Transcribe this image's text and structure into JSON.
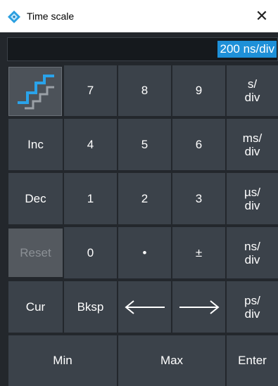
{
  "window": {
    "title": "Time scale",
    "close_label": "✕"
  },
  "display": {
    "value": "200 ns/div"
  },
  "keys": {
    "step_icon": "step-icon",
    "seven": "7",
    "eight": "8",
    "nine": "9",
    "unit_s": "s/\ndiv",
    "inc": "Inc",
    "four": "4",
    "five": "5",
    "six": "6",
    "unit_ms": "ms/\ndiv",
    "dec": "Dec",
    "one": "1",
    "two": "2",
    "three": "3",
    "unit_us": "µs/\ndiv",
    "reset": "Reset",
    "zero": "0",
    "dot": "•",
    "plus_minus": "±",
    "unit_ns": "ns/\ndiv",
    "cur": "Cur",
    "bksp": "Bksp",
    "unit_ps": "ps/\ndiv",
    "min": "Min",
    "max": "Max",
    "enter": "Enter"
  },
  "colors": {
    "accent": "#1e90d8",
    "panel": "#23272c",
    "key": "#3b424a",
    "disabled": "#54595f"
  }
}
